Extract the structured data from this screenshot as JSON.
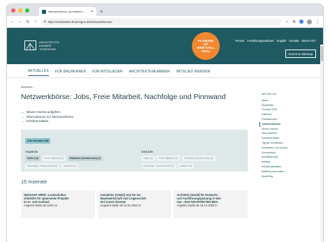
{
  "browser": {
    "tab_title": "Netzwerkbörse | Architekten ...",
    "url": "https://architekten-thueringen.de/netzwerkboerse/",
    "colors": {
      "red": "#ff5f57",
      "yellow": "#febc2e",
      "green": "#28c840"
    }
  },
  "header": {
    "logo_lines": [
      "ARCHITEKTEN",
      "KAMMER",
      "THÜRINGEN"
    ],
    "badge_lines": [
      "PLANUNG",
      "IST",
      "WERTVOLL"
    ],
    "badge_tag": "#WIAL",
    "top_links": [
      "Presse",
      "Fortbildungsanbieter",
      "English",
      "Kontakt",
      "Meine AKT"
    ],
    "search_label": "Suche & Sitemap",
    "brand_color": "#1f5962",
    "badge_color": "#f2872e"
  },
  "nav": [
    "AKTUELLES",
    "FÜR BAUHERREN",
    "FÜR MITGLIEDER",
    "ARCHITEKTENKAMMER",
    "MITGLIED WERDEN"
  ],
  "main": {
    "breadcrumb": "Aktuelles /",
    "title": "Netzwerkbörse: Jobs, Freie Mitarbeit, Nachfolge und Pinnwand",
    "links": [
      "Neues Inserat aufgeben",
      "Informationen zur Netzwerkbörse",
      "Schülerpraktika"
    ],
    "filter": {
      "all_label": "Alle Inserate (15)",
      "angebote": {
        "heading": "Angebote",
        "chips": [
          {
            "label": "Stelle (14)",
            "on": true
          },
          {
            "label": "Freie Mitarbeit (0)",
            "on": false
          },
          {
            "label": "Praktikum (Studierende) (1)",
            "on": true
          },
          {
            "label": "Nachfolge / Partnerschaft (0)",
            "on": false
          },
          {
            "label": "anderes (0)",
            "on": false
          }
        ]
      },
      "gesuche": {
        "heading": "Gesuche",
        "chips": [
          {
            "label": "Stelle (0)",
            "on": false
          },
          {
            "label": "Freie Mitarbeit (0)",
            "on": false
          },
          {
            "label": "Praktikum (Studierende) (0)",
            "on": false
          },
          {
            "label": "Nachfolge / Partnerschaft (0)",
            "on": false
          },
          {
            "label": "anderes (0)",
            "on": false
          }
        ]
      }
    },
    "count": "15 Inserate",
    "cards": [
      {
        "title_lines": [
          "GESUCHT WIRD: Landschaftar-",
          "chitekt/in für spannende Projekte",
          "im In- und Ausland"
        ],
        "meta": "Angebot Stelle ab sofort in"
      },
      {
        "title_lines": [
          "Amtsleiter (m/w/d) Amt für Ge-",
          "bäudewirtschaft und Liegenschaf-",
          "ten/ Innere Dienste"
        ],
        "meta": "Angebot Stelle ab 10.01.2024 in"
      },
      {
        "title_lines": [
          "Architekt (m/w/d) für Entwurfs-",
          "und Ausführungsplanung in Wei-",
          "mar - B19 ARCHITEKTEN BDA"
        ],
        "meta": "Angebot Stelle ab 19.12.2023 in"
      }
    ]
  },
  "sidebar": [
    {
      "label": "AKTUELLES",
      "active": false
    },
    {
      "label": "News",
      "active": false
    },
    {
      "label": "Newsletter",
      "active": false
    },
    {
      "label": "Chronik 2023",
      "active": false
    },
    {
      "label": "Kalender",
      "active": false
    },
    {
      "label": "Fortbildungen",
      "active": false
    },
    {
      "label": "Netzwerkbörse",
      "active": true
    },
    {
      "label": "Neues Inserat",
      "active": false
    },
    {
      "label": "Informationen",
      "active": false
    },
    {
      "label": "Schülerpraktika",
      "active": false
    },
    {
      "label": "Tag der Architektur",
      "active": false
    },
    {
      "label": "Architektur und Schule",
      "active": false
    },
    {
      "label": "Sommerfest",
      "active": false
    },
    {
      "label": "Architekturtag",
      "active": false
    },
    {
      "label": "Bautag",
      "active": false
    },
    {
      "label": "Inklusiv gestalten",
      "active": false
    },
    {
      "label": "Building Information",
      "active": false
    },
    {
      "label": "Modelling",
      "active": false
    }
  ]
}
